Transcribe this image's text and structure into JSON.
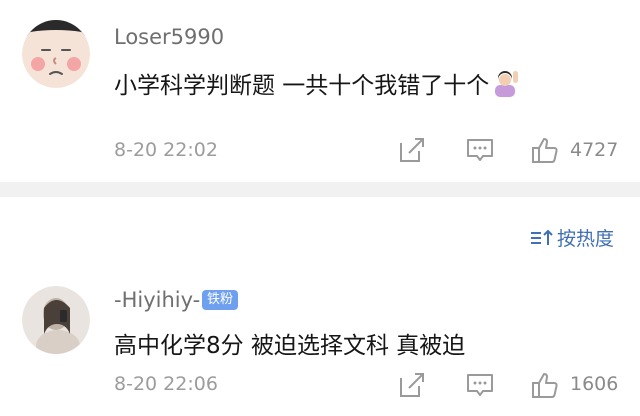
{
  "comments": [
    {
      "username": "Loser5990",
      "text": "小学科学判断题 一共十个我错了十个",
      "time": "8-20 22:02",
      "likes": "4727",
      "avatar_icon": "cartoon-face-avatar",
      "emoji_icon": "person-raising-hand-emoji"
    },
    {
      "username": "-Hiyihiy-",
      "badge": "铁粉",
      "text": "高中化学8分 被迫选择文科 真被迫",
      "time": "8-20 22:06",
      "likes": "1606",
      "avatar_icon": "photo-avatar"
    }
  ],
  "sort": {
    "label": "按热度",
    "icon": "sort-icon"
  },
  "colors": {
    "link": "#3f6fb5",
    "badge": "#6fa0f0",
    "divider": "#f1f1f1",
    "meta": "#9c9c9c"
  }
}
